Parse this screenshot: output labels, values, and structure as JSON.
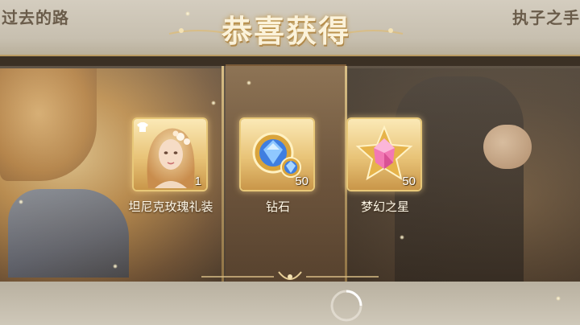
{
  "header": {
    "title": "恭喜获得",
    "corner_left": "过去的路",
    "corner_right": "执子之手"
  },
  "rewards": [
    {
      "name": "坦尼克玫瑰礼装",
      "quantity": "1",
      "icon": "costume-portrait"
    },
    {
      "name": "钻石",
      "quantity": "50",
      "icon": "diamond-gem"
    },
    {
      "name": "梦幻之星",
      "quantity": "50",
      "icon": "pink-star-gem"
    }
  ],
  "colors": {
    "title_glow": "#c49a4c",
    "frame_gold": "#d9bf86",
    "card_gold": "#e8c878"
  }
}
